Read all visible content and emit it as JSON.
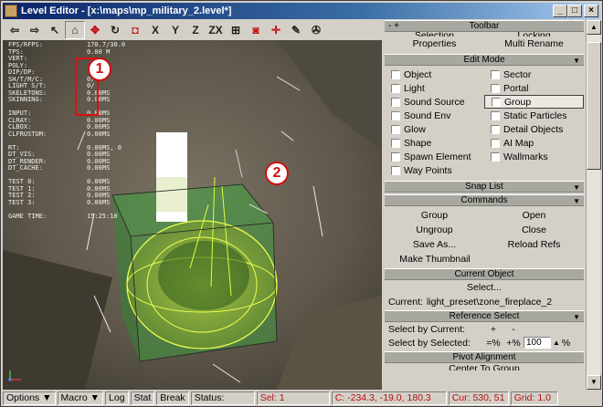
{
  "window": {
    "title": "Level Editor - [x:\\maps\\mp_military_2.level*]",
    "min": "_",
    "max": "□",
    "close": "×"
  },
  "toolbar": {
    "buttons": [
      "⇦",
      "⇨",
      "↖",
      "⌂",
      "✥",
      "↻",
      "◘",
      "X",
      "Y",
      "Z",
      "ZX",
      "⊞",
      "◙",
      "✛",
      "✎",
      "✇"
    ]
  },
  "stats": [
    [
      "FPS/RFPS:",
      "170.7/30.0"
    ],
    [
      "TPS:",
      "0.00 M"
    ],
    [
      "VERT:",
      ""
    ],
    [
      "POLY:",
      ""
    ],
    [
      "DIP/DP:",
      ""
    ],
    [
      "SH/T/M/C:",
      "0/"
    ],
    [
      "LIGHT S/T:",
      "0/"
    ],
    [
      "SKELETONS:",
      "0.00MS"
    ],
    [
      "SKINNING:",
      "0.00MS"
    ],
    [
      "",
      ""
    ],
    [
      "INPUT:",
      "0.00MS"
    ],
    [
      "CLRAY:",
      "0.00MS"
    ],
    [
      "CLBOX:",
      "0.00MS"
    ],
    [
      "CLFRUSTUM:",
      "0.00MS"
    ],
    [
      "",
      ""
    ],
    [
      "RT:",
      "0.00MS, 0"
    ],
    [
      "DT_VIS:",
      "0.00MS"
    ],
    [
      "DT_RENDER:",
      "0.00MS"
    ],
    [
      "DT_CACHE:",
      "0.00MS"
    ],
    [
      "",
      ""
    ],
    [
      "TEST 0:",
      "0.00MS"
    ],
    [
      "TEST 1:",
      "0.00MS"
    ],
    [
      "TEST 2:",
      "0.00MS"
    ],
    [
      "TEST 3:",
      "0.00MS"
    ],
    [
      "",
      ""
    ],
    [
      "GAME TIME:",
      "15:25:10"
    ]
  ],
  "markers": {
    "one": "1",
    "two": "2"
  },
  "panel": {
    "toolbar_header": "Toolbar",
    "toolbar_pm": "- +",
    "selection_label": "Selection",
    "locking_label": "Locking",
    "properties": "Properties",
    "multi_rename": "Multi Rename",
    "edit_mode": "Edit Mode",
    "modes": [
      [
        "Object",
        "Sector"
      ],
      [
        "Light",
        "Portal"
      ],
      [
        "Sound Source",
        "Group"
      ],
      [
        "Sound Env",
        "Static Particles"
      ],
      [
        "Glow",
        "Detail Objects"
      ],
      [
        "Shape",
        "AI Map"
      ],
      [
        "Spawn Element",
        "Wallmarks"
      ],
      [
        "Way Points",
        ""
      ]
    ],
    "snap_list": "Snap List",
    "commands": "Commands",
    "cmd_rows": [
      [
        "Group",
        "Open"
      ],
      [
        "Ungroup",
        "Close"
      ],
      [
        "Save As...",
        "Reload Refs"
      ]
    ],
    "make_thumbnail": "Make Thumbnail",
    "current_object": "Current Object",
    "select_btn": "Select...",
    "current_label": "Current:",
    "current_value": "light_preset\\zone_fireplace_2",
    "reference_select": "Reference Select",
    "select_by_current": "Select by Current:",
    "plus": "+",
    "minus": "-",
    "select_by_selected": "Select by Selected:",
    "eq_pct": "=%",
    "plus_pct": "+%",
    "pct_value": "100",
    "pct_sign": "%",
    "pivot_alignment": "Pivot Alignment",
    "center_to_group": "Center To Group"
  },
  "status": {
    "options": "Options",
    "macro": "Macro",
    "log": "Log",
    "stat": "Stat",
    "break": "Break",
    "status": "Status:",
    "sel": "Sel: 1",
    "coords": "C: -234.3, -19.0, 180.3",
    "cur": "Cur: 530, 51",
    "grid": "Grid: 1.0"
  },
  "colors": {
    "accent": "#d01010",
    "selection_box": "#3cb43c",
    "light_sphere": "#e6ff3c"
  }
}
